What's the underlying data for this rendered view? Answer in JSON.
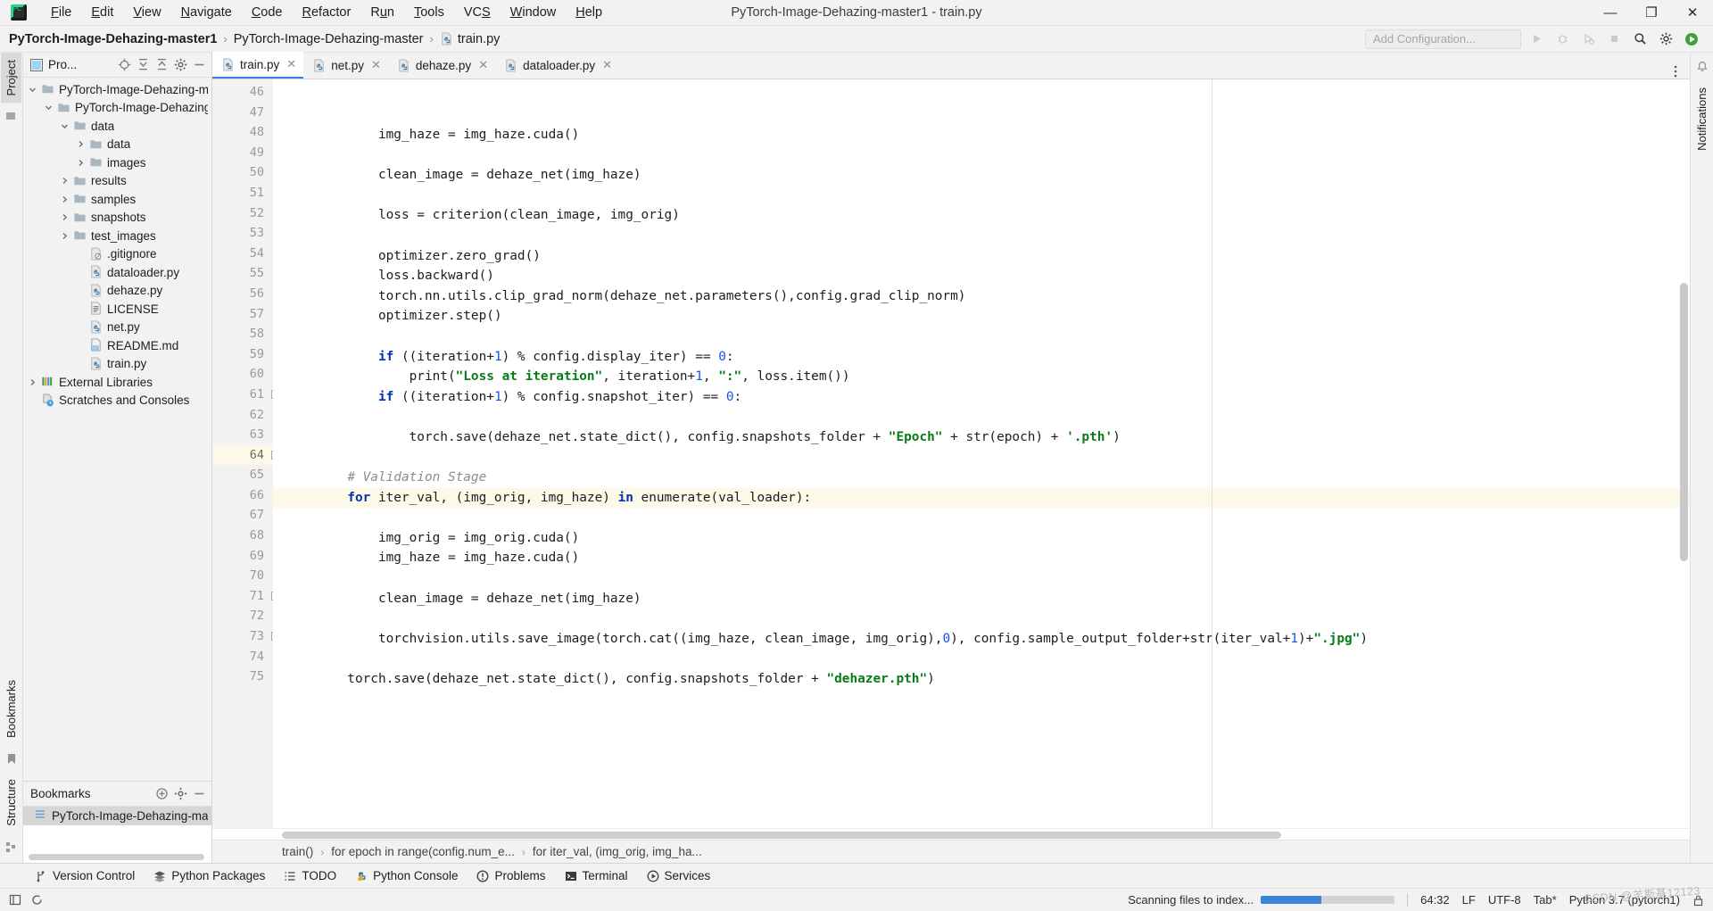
{
  "window": {
    "title": "PyTorch-Image-Dehazing-master1 - train.py",
    "minimize": "—",
    "maximize": "❐",
    "close": "✕"
  },
  "menubar": {
    "items": [
      "File",
      "Edit",
      "View",
      "Navigate",
      "Code",
      "Refactor",
      "Run",
      "Tools",
      "VCS",
      "Window",
      "Help"
    ]
  },
  "navbar": {
    "breadcrumbs": [
      {
        "label": "PyTorch-Image-Dehazing-master1",
        "icon": "none",
        "bold": true
      },
      {
        "label": "PyTorch-Image-Dehazing-master",
        "icon": "none",
        "bold": false
      },
      {
        "label": "train.py",
        "icon": "python-file-icon",
        "bold": false
      }
    ],
    "run_config_placeholder": "Add Configuration...",
    "icons": [
      "run-icon",
      "debug-icon",
      "coverage-icon",
      "stop-icon",
      "search-icon",
      "settings-icon",
      "ide-helper-icon"
    ]
  },
  "left_strip": {
    "tabs": [
      "Project",
      "Bookmarks",
      "Structure"
    ],
    "selected": "Project"
  },
  "project_panel": {
    "title": "Pro...",
    "tools": [
      "locate-icon",
      "expand-all-icon",
      "collapse-all-icon",
      "settings-icon",
      "hide-icon"
    ],
    "tree": [
      {
        "label": "PyTorch-Image-Dehazing-mas",
        "depth": 0,
        "arrow": "down",
        "icon": "folder-icon"
      },
      {
        "label": "PyTorch-Image-Dehazing-",
        "depth": 1,
        "arrow": "down",
        "icon": "folder-icon"
      },
      {
        "label": "data",
        "depth": 2,
        "arrow": "down",
        "icon": "folder-icon"
      },
      {
        "label": "data",
        "depth": 3,
        "arrow": "right",
        "icon": "folder-icon"
      },
      {
        "label": "images",
        "depth": 3,
        "arrow": "right",
        "icon": "folder-icon"
      },
      {
        "label": "results",
        "depth": 2,
        "arrow": "right",
        "icon": "folder-icon"
      },
      {
        "label": "samples",
        "depth": 2,
        "arrow": "right",
        "icon": "folder-icon"
      },
      {
        "label": "snapshots",
        "depth": 2,
        "arrow": "right",
        "icon": "folder-icon"
      },
      {
        "label": "test_images",
        "depth": 2,
        "arrow": "right",
        "icon": "folder-icon"
      },
      {
        "label": ".gitignore",
        "depth": 3,
        "arrow": "none",
        "icon": "gitignore-file-icon"
      },
      {
        "label": "dataloader.py",
        "depth": 3,
        "arrow": "none",
        "icon": "python-file-icon"
      },
      {
        "label": "dehaze.py",
        "depth": 3,
        "arrow": "none",
        "icon": "python-file-icon"
      },
      {
        "label": "LICENSE",
        "depth": 3,
        "arrow": "none",
        "icon": "text-file-icon"
      },
      {
        "label": "net.py",
        "depth": 3,
        "arrow": "none",
        "icon": "python-file-icon"
      },
      {
        "label": "README.md",
        "depth": 3,
        "arrow": "none",
        "icon": "markdown-file-icon"
      },
      {
        "label": "train.py",
        "depth": 3,
        "arrow": "none",
        "icon": "python-file-icon"
      },
      {
        "label": "External Libraries",
        "depth": 0,
        "arrow": "right",
        "icon": "libraries-icon"
      },
      {
        "label": "Scratches and Consoles",
        "depth": 0,
        "arrow": "none",
        "icon": "scratches-icon"
      }
    ]
  },
  "bookmarks_panel": {
    "title": "Bookmarks",
    "tools": [
      "add-icon",
      "settings-icon",
      "hide-icon"
    ],
    "items": [
      {
        "label": "PyTorch-Image-Dehazing-mas",
        "icon": "bookmark-list-icon",
        "selected": true
      }
    ]
  },
  "editor_tabs": [
    {
      "label": "train.py",
      "icon": "python-file-icon",
      "active": true
    },
    {
      "label": "net.py",
      "icon": "python-file-icon",
      "active": false
    },
    {
      "label": "dehaze.py",
      "icon": "python-file-icon",
      "active": false
    },
    {
      "label": "dataloader.py",
      "icon": "python-file-icon",
      "active": false
    }
  ],
  "editor": {
    "first_line": 46,
    "current_line": 64,
    "lines": [
      {
        "n": 46,
        "indent": 12,
        "fold": false,
        "tokens": [
          {
            "t": "img_haze = img_haze.cuda()",
            "c": ""
          }
        ]
      },
      {
        "n": 47,
        "indent": 0,
        "fold": false,
        "tokens": []
      },
      {
        "n": 48,
        "indent": 12,
        "fold": false,
        "tokens": [
          {
            "t": "clean_image = dehaze_net(img_haze)",
            "c": ""
          }
        ]
      },
      {
        "n": 49,
        "indent": 0,
        "fold": false,
        "tokens": []
      },
      {
        "n": 50,
        "indent": 12,
        "fold": false,
        "tokens": [
          {
            "t": "loss = criterion(clean_image, img_orig)",
            "c": ""
          }
        ]
      },
      {
        "n": 51,
        "indent": 0,
        "fold": false,
        "tokens": []
      },
      {
        "n": 52,
        "indent": 12,
        "fold": false,
        "tokens": [
          {
            "t": "optimizer.zero_grad()",
            "c": ""
          }
        ]
      },
      {
        "n": 53,
        "indent": 12,
        "fold": false,
        "tokens": [
          {
            "t": "loss.backward()",
            "c": ""
          }
        ]
      },
      {
        "n": 54,
        "indent": 12,
        "fold": false,
        "tokens": [
          {
            "t": "torch.nn.utils.clip_grad_norm(dehaze_net.parameters(),config.grad_clip_norm)",
            "c": ""
          }
        ]
      },
      {
        "n": 55,
        "indent": 12,
        "fold": false,
        "tokens": [
          {
            "t": "optimizer.step()",
            "c": ""
          }
        ]
      },
      {
        "n": 56,
        "indent": 0,
        "fold": false,
        "tokens": []
      },
      {
        "n": 57,
        "indent": 12,
        "fold": false,
        "tokens": [
          {
            "t": "if",
            "c": "kw"
          },
          {
            "t": " ((iteration+",
            "c": ""
          },
          {
            "t": "1",
            "c": "num"
          },
          {
            "t": ") % config.display_iter) == ",
            "c": ""
          },
          {
            "t": "0",
            "c": "num"
          },
          {
            "t": ":",
            "c": ""
          }
        ]
      },
      {
        "n": 58,
        "indent": 16,
        "fold": false,
        "tokens": [
          {
            "t": "print(",
            "c": ""
          },
          {
            "t": "\"Loss at iteration\"",
            "c": "str"
          },
          {
            "t": ", iteration+",
            "c": ""
          },
          {
            "t": "1",
            "c": "num"
          },
          {
            "t": ", ",
            "c": ""
          },
          {
            "t": "\":\"",
            "c": "str"
          },
          {
            "t": ", loss.item())",
            "c": ""
          }
        ]
      },
      {
        "n": 59,
        "indent": 12,
        "fold": false,
        "tokens": [
          {
            "t": "if",
            "c": "kw"
          },
          {
            "t": " ((iteration+",
            "c": ""
          },
          {
            "t": "1",
            "c": "num"
          },
          {
            "t": ") % config.snapshot_iter) == ",
            "c": ""
          },
          {
            "t": "0",
            "c": "num"
          },
          {
            "t": ":",
            "c": ""
          }
        ]
      },
      {
        "n": 60,
        "indent": 0,
        "fold": false,
        "tokens": []
      },
      {
        "n": 61,
        "indent": 16,
        "fold": true,
        "tokens": [
          {
            "t": "torch.save(dehaze_net.state_dict(), config.snapshots_folder + ",
            "c": ""
          },
          {
            "t": "\"Epoch\"",
            "c": "str"
          },
          {
            "t": " + str(epoch) + ",
            "c": ""
          },
          {
            "t": "'.pth'",
            "c": "str"
          },
          {
            "t": ")",
            "c": ""
          }
        ]
      },
      {
        "n": 62,
        "indent": 0,
        "fold": false,
        "tokens": []
      },
      {
        "n": 63,
        "indent": 8,
        "fold": false,
        "tokens": [
          {
            "t": "# Validation Stage",
            "c": "cmt"
          }
        ]
      },
      {
        "n": 64,
        "indent": 8,
        "fold": true,
        "tokens": [
          {
            "t": "for",
            "c": "kw"
          },
          {
            "t": " iter_val, (img_orig, img_haze) ",
            "c": ""
          },
          {
            "t": "in",
            "c": "kw"
          },
          {
            "t": " enumerate(val_loader):",
            "c": ""
          }
        ]
      },
      {
        "n": 65,
        "indent": 0,
        "fold": false,
        "tokens": []
      },
      {
        "n": 66,
        "indent": 12,
        "fold": false,
        "tokens": [
          {
            "t": "img_orig = img_orig.cuda()",
            "c": ""
          }
        ]
      },
      {
        "n": 67,
        "indent": 12,
        "fold": false,
        "tokens": [
          {
            "t": "img_haze = img_haze.cuda()",
            "c": ""
          }
        ]
      },
      {
        "n": 68,
        "indent": 0,
        "fold": false,
        "tokens": []
      },
      {
        "n": 69,
        "indent": 12,
        "fold": false,
        "tokens": [
          {
            "t": "clean_image = dehaze_net(img_haze)",
            "c": ""
          }
        ]
      },
      {
        "n": 70,
        "indent": 0,
        "fold": false,
        "tokens": []
      },
      {
        "n": 71,
        "indent": 12,
        "fold": true,
        "tokens": [
          {
            "t": "torchvision.utils.save_image(torch.cat((img_haze, clean_image, img_orig),",
            "c": ""
          },
          {
            "t": "0",
            "c": "num"
          },
          {
            "t": "), config.sample_output_folder+str(iter_val+",
            "c": ""
          },
          {
            "t": "1",
            "c": "num"
          },
          {
            "t": ")+",
            "c": ""
          },
          {
            "t": "\".jpg\"",
            "c": "str"
          },
          {
            "t": ")",
            "c": ""
          }
        ]
      },
      {
        "n": 72,
        "indent": 0,
        "fold": false,
        "tokens": []
      },
      {
        "n": 73,
        "indent": 8,
        "fold": true,
        "tokens": [
          {
            "t": "torch.save(dehaze_net.state_dict(), config.snapshots_folder + ",
            "c": ""
          },
          {
            "t": "\"dehazer.pth\"",
            "c": "str"
          },
          {
            "t": ")",
            "c": ""
          }
        ]
      },
      {
        "n": 74,
        "indent": 0,
        "fold": false,
        "tokens": []
      },
      {
        "n": 75,
        "indent": 0,
        "fold": false,
        "tokens": []
      }
    ]
  },
  "editor_breadcrumbs": [
    "train()",
    "for epoch in range(config.num_e...",
    "for iter_val, (img_orig, img_ha..."
  ],
  "right_strip": {
    "tabs": [
      "Notifications"
    ]
  },
  "bottom_toolwindows": [
    {
      "label": "Version Control",
      "icon": "branch-icon"
    },
    {
      "label": "Python Packages",
      "icon": "packages-icon"
    },
    {
      "label": "TODO",
      "icon": "todo-icon"
    },
    {
      "label": "Python Console",
      "icon": "python-icon"
    },
    {
      "label": "Problems",
      "icon": "problems-icon"
    },
    {
      "label": "Terminal",
      "icon": "terminal-icon"
    },
    {
      "label": "Services",
      "icon": "services-icon"
    }
  ],
  "statusbar": {
    "left_icons": [
      "layout-icon",
      "refresh-icon"
    ],
    "progress_text": "Scanning files to index...",
    "progress_percent": 45,
    "caret_position": "64:32",
    "line_separator": "LF",
    "encoding": "UTF-8",
    "indent": "Tab*",
    "interpreter": "Python 3.7 (pytorch1)",
    "watermark": "CSDN @羊斯基12123"
  },
  "colors": {
    "accent": "#3b7ddd",
    "keyword": "#0033b3",
    "string": "#067d17",
    "number": "#1750eb",
    "comment": "#8c8c8c",
    "current_line_bg": "#fcf9e8",
    "progress_fill": "#3b84d8"
  }
}
